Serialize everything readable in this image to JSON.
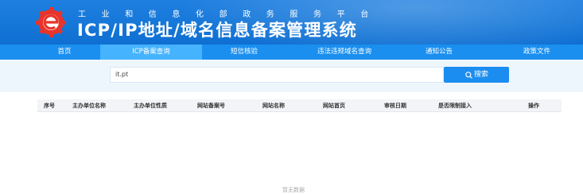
{
  "header": {
    "subtitle": "工业和信息化部政务服务平台",
    "title": "ICP/IP地址/域名信息备案管理系统",
    "logo_icon": "e-gear-logo-icon"
  },
  "nav": {
    "items": [
      {
        "label": "首页",
        "active": false
      },
      {
        "label": "ICP备案查询",
        "active": true
      },
      {
        "label": "短信核验",
        "active": false
      },
      {
        "label": "违法违规域名查询",
        "active": false
      },
      {
        "label": "通知公告",
        "active": false
      },
      {
        "label": "政策文件",
        "active": false
      }
    ]
  },
  "search": {
    "value": "it.pt",
    "button_label": "搜索",
    "button_icon": "search-icon"
  },
  "table": {
    "columns": [
      "序号",
      "主办单位名称",
      "主办单位性质",
      "网站备案号",
      "网站名称",
      "网站首页",
      "审核日期",
      "是否限制接入",
      "操作"
    ],
    "empty_text": "暂无数据"
  },
  "colors": {
    "header_blue": "#1577d8",
    "nav_blue": "#1a8ff0",
    "nav_active": "#46b3ff",
    "button_blue": "#1b8df0"
  }
}
